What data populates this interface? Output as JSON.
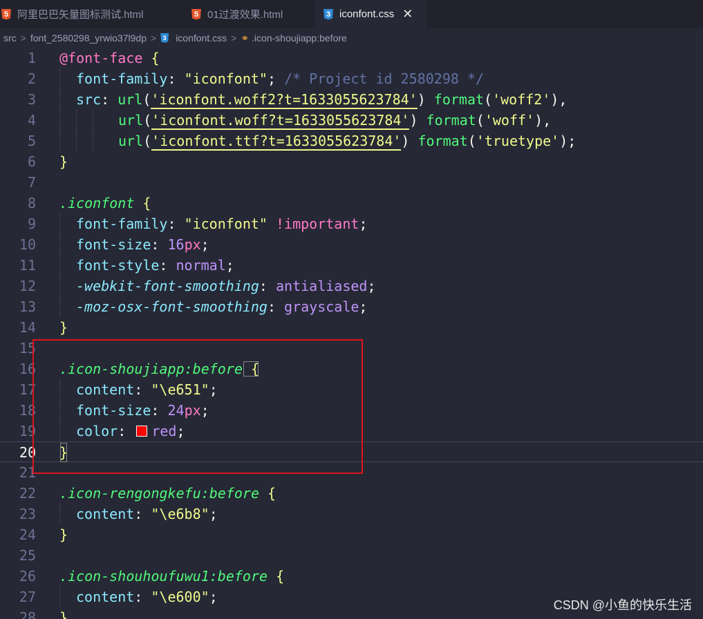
{
  "tabs": [
    {
      "label": "阿里巴巴矢量图标测试.html",
      "icon": "html5-icon"
    },
    {
      "label": "01过渡效果.html",
      "icon": "html5-icon"
    },
    {
      "label": "iconfont.css",
      "icon": "css3-icon",
      "active": true
    }
  ],
  "breadcrumb": {
    "items": [
      "src",
      "font_2580298_yrwio37l9dp",
      "iconfont.css",
      ".icon-shoujiapp:before"
    ],
    "separator": ">"
  },
  "editor": {
    "line_numbers": [
      "1",
      "2",
      "3",
      "4",
      "5",
      "6",
      "7",
      "8",
      "9",
      "10",
      "11",
      "12",
      "13",
      "14",
      "15",
      "16",
      "17",
      "18",
      "19",
      "20",
      "21",
      "22",
      "23",
      "24",
      "25",
      "26",
      "27",
      "28"
    ],
    "current_line": "20",
    "code": {
      "l1_at": "@font-face",
      "l1_br": " {",
      "l2_prop": "font-family",
      "l2_colon": ": ",
      "l2_str": "\"iconfont\"",
      "l2_semi": "; ",
      "l2_comment": "/* Project id 2580298 */",
      "l3_prop": "src",
      "l3_colon": ": ",
      "l3_url": "url",
      "l3_arg": "'iconfont.woff2?t=1633055623784'",
      "l3_fmt": "format",
      "l3_fmtarg": "'woff2'",
      "l3_end": "),",
      "l4_url": "url",
      "l4_arg": "'iconfont.woff?t=1633055623784'",
      "l4_fmt": "format",
      "l4_fmtarg": "'woff'",
      "l4_end": "),",
      "l5_url": "url",
      "l5_arg": "'iconfont.ttf?t=1633055623784'",
      "l5_fmt": "format",
      "l5_fmtarg": "'truetype'",
      "l5_end": ");",
      "l6": "}",
      "l8_sel": ".iconfont",
      "l8_br": " {",
      "l9_prop": "font-family",
      "l9_str": "\"iconfont\"",
      "l9_imp": "!important",
      "l10_prop": "font-size",
      "l10_num": "16",
      "l10_unit": "px",
      "l11_prop": "font-style",
      "l11_val": "normal",
      "l12_prop": "-webkit-font-smoothing",
      "l12_val": "antialiased",
      "l13_prop": "-moz-osx-font-smoothing",
      "l13_val": "grayscale",
      "l14": "}",
      "l16_sel": ".icon-shoujiapp",
      "l16_pseudo": ":before",
      "l16_br": " {",
      "l17_prop": "content",
      "l17_str": "\"\\e651\"",
      "l18_prop": "font-size",
      "l18_num": "24",
      "l18_unit": "px",
      "l19_prop": "color",
      "l19_val": "red",
      "l19_swatch_color": "#ff0000",
      "l20": "}",
      "l22_sel": ".icon-rengongkefu",
      "l22_pseudo": ":before",
      "l22_br": " {",
      "l23_prop": "content",
      "l23_str": "\"\\e6b8\"",
      "l24": "}",
      "l26_sel": ".icon-shouhoufuwu1",
      "l26_pseudo": ":before",
      "l26_br": " {",
      "l27_prop": "content",
      "l27_str": "\"\\e600\"",
      "l28": "}"
    }
  },
  "watermark": "CSDN @小鱼的快乐生活",
  "colors": {
    "background": "#262835",
    "highlight_box": "#e0141c",
    "swatch": "#ff0000"
  }
}
